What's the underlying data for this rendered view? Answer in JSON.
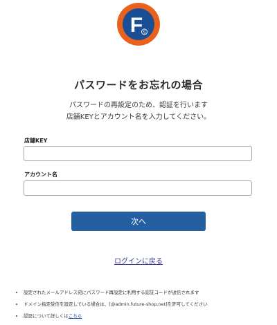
{
  "logo": {
    "letter": "F",
    "badge": "S",
    "colors": {
      "outer": "#e8621e",
      "inner": "#1b4f95",
      "letter": "#ffffff"
    }
  },
  "header": {
    "title": "パスワードをお忘れの場合",
    "description_line1": "パスワードの再設定のため、認証を行います",
    "description_line2": "店舗KEYとアカウント名を入力してください。"
  },
  "form": {
    "store_key": {
      "label": "店舗KEY",
      "value": "",
      "placeholder": ""
    },
    "account_name": {
      "label": "アカウント名",
      "value": "",
      "placeholder": ""
    },
    "next_button_label": "次へ"
  },
  "links": {
    "back_to_login": "ログインに戻る"
  },
  "notes": {
    "items": [
      "設定されたメールアドレス宛にパスワード再設定に利用する認証コードが送信されます",
      "ドメイン指定受信を設定している場合は、[@admin.future-shop.net]を許可してください"
    ],
    "details_prefix": "認証について詳しくは",
    "details_link": "こちら"
  },
  "colors": {
    "primary_button": "#255fa2",
    "link": "#3b3b8f"
  }
}
